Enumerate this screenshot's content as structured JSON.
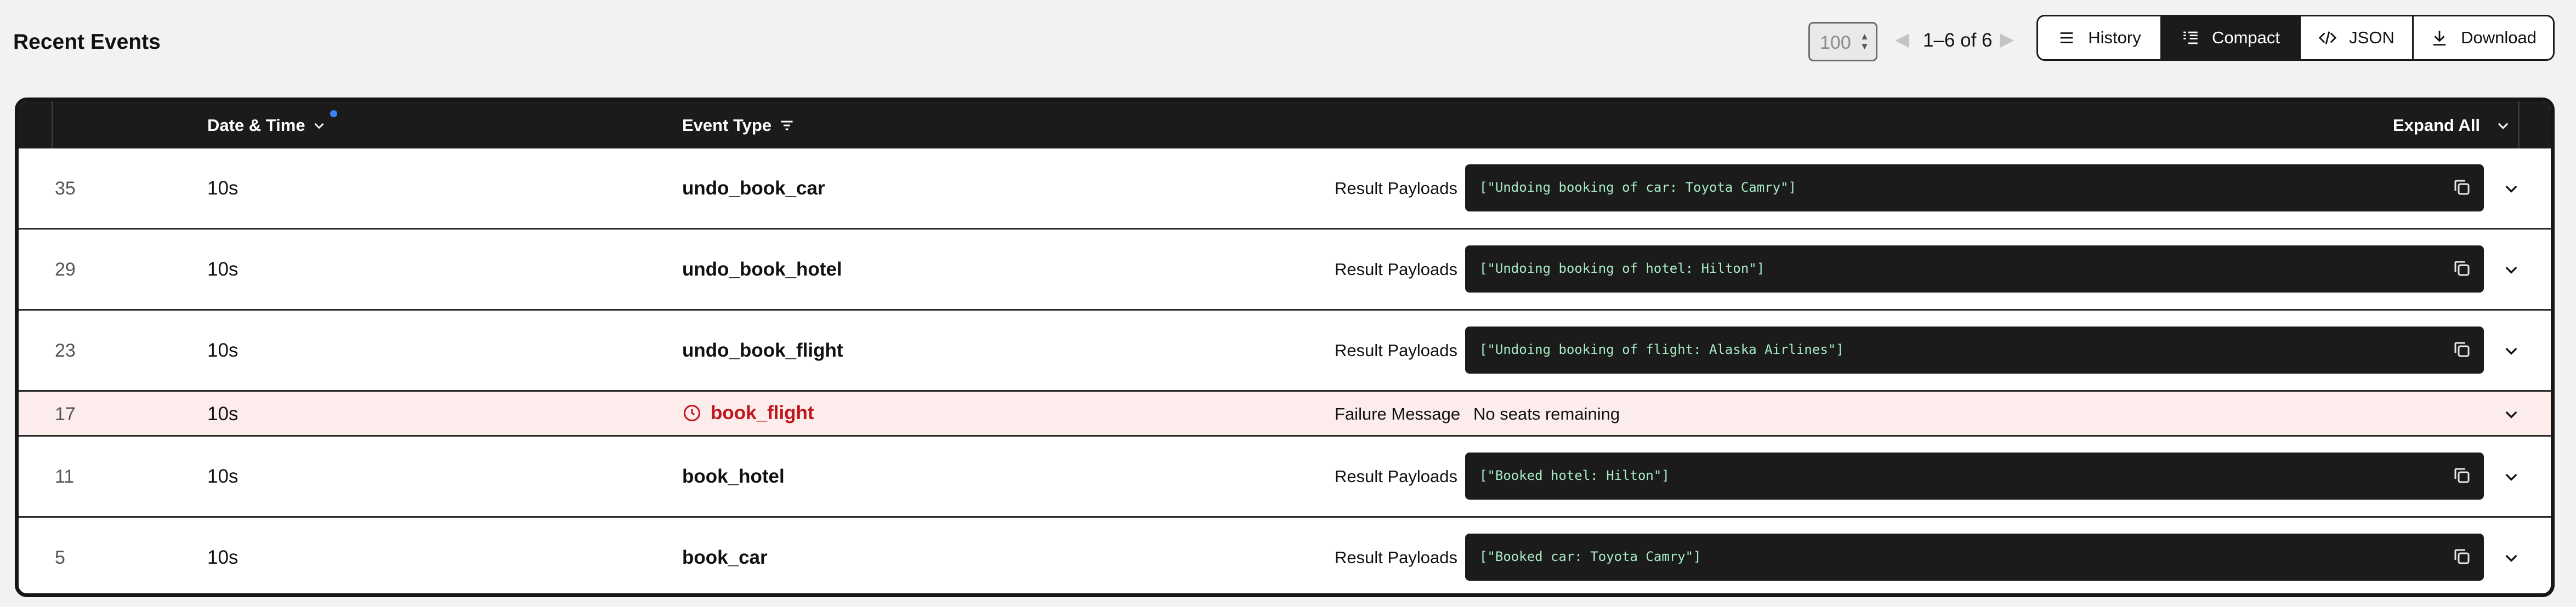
{
  "header": {
    "title": "Recent Events",
    "page_size": "100",
    "pagination_text": "1–6 of 6",
    "views": [
      {
        "label": "History",
        "icon": "menu-lines-icon",
        "active": false
      },
      {
        "label": "Compact",
        "icon": "compact-list-icon",
        "active": true
      },
      {
        "label": "JSON",
        "icon": "code-icon",
        "active": false
      },
      {
        "label": "Download",
        "icon": "download-icon",
        "active": false
      }
    ]
  },
  "table": {
    "columns": {
      "date_time": "Date & Time",
      "event_type": "Event Type",
      "expand_all": "Expand All"
    },
    "rows": [
      {
        "id": "35",
        "time": "10s",
        "type": "undo_book_car",
        "label": "Result Payloads",
        "payload": "[\"Undoing booking of car: Toyota Camry\"]"
      },
      {
        "id": "29",
        "time": "10s",
        "type": "undo_book_hotel",
        "label": "Result Payloads",
        "payload": "[\"Undoing booking of hotel: Hilton\"]"
      },
      {
        "id": "23",
        "time": "10s",
        "type": "undo_book_flight",
        "label": "Result Payloads",
        "payload": "[\"Undoing booking of flight: Alaska Airlines\"]"
      },
      {
        "id": "17",
        "time": "10s",
        "type": "book_flight",
        "label": "Failure Message",
        "message": "No seats remaining",
        "status": "failed"
      },
      {
        "id": "11",
        "time": "10s",
        "type": "book_hotel",
        "label": "Result Payloads",
        "payload": "[\"Booked hotel: Hilton\"]"
      },
      {
        "id": "5",
        "time": "10s",
        "type": "book_car",
        "label": "Result Payloads",
        "payload": "[\"Booked car: Toyota Camry\"]"
      }
    ]
  },
  "colors": {
    "header_bg": "#1b1b1b",
    "payload_text": "#a7ecc4",
    "failure_text": "#c0161d",
    "failure_row_bg": "#fdecec",
    "sort_indicator": "#3b82f6"
  }
}
